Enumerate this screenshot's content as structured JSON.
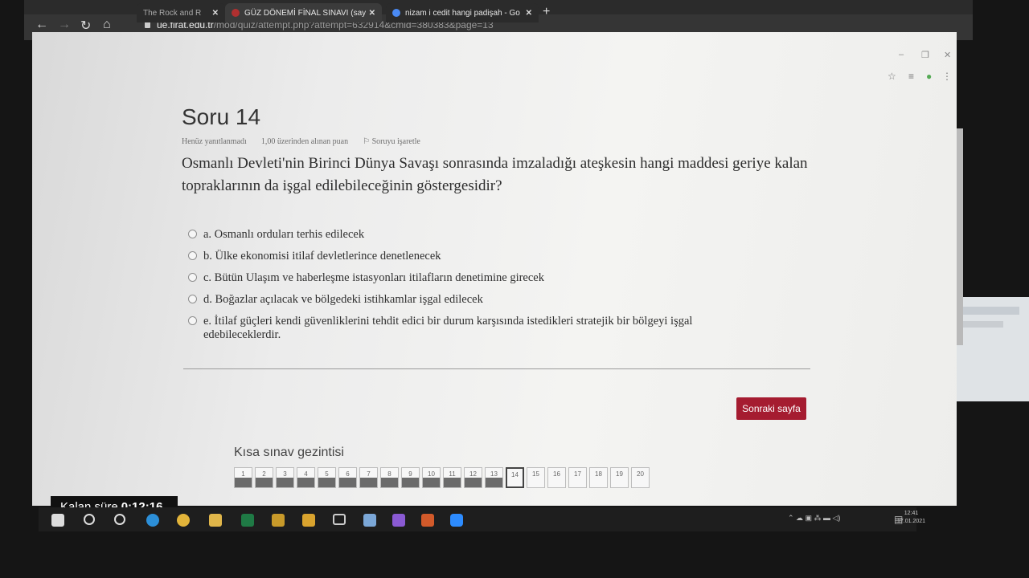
{
  "browser": {
    "tabs": [
      {
        "label": "The Rock and R",
        "active": false
      },
      {
        "label": "GÜZ DÖNEMİ FİNAL SINAVI (say",
        "active": true
      },
      {
        "label": "nizam i cedit hangi padişah - Go",
        "active": false
      }
    ],
    "url_host": "ue.firat.edu.tr",
    "url_path": "/mod/quiz/attempt.php?attempt=632914&cmid=380383&page=13"
  },
  "question": {
    "title": "Soru 14",
    "status": "Henüz yanıtlanmadı",
    "points": "1,00 üzerinden alınan puan",
    "flag_label": "Soruyu işaretle",
    "text": "Osmanlı Devleti'nin Birinci Dünya Savaşı sonrasında imzaladığı ateşkesin hangi maddesi geriye kalan topraklarının da işgal edilebileceğinin göstergesidir?",
    "answers": [
      "a. Osmanlı orduları terhis edilecek",
      "b. Ülke ekonomisi itilaf devletlerince denetlenecek",
      "c. Bütün Ulaşım ve haberleşme istasyonları itilafların denetimine girecek",
      "d. Boğazlar açılacak ve bölgedeki istihkamlar işgal edilecek",
      "e. İtilaf güçleri kendi güvenliklerini tehdit edici bir durum karşısında istedikleri stratejik bir bölgeyi işgal edebileceklerdir."
    ]
  },
  "next_button": "Sonraki sayfa",
  "navigation": {
    "title": "Kısa sınav gezintisi",
    "cells": [
      "1",
      "2",
      "3",
      "4",
      "5",
      "6",
      "7",
      "8",
      "9",
      "10",
      "11",
      "12",
      "13",
      "14",
      "15",
      "16",
      "17",
      "18",
      "19",
      "20"
    ],
    "answered_count": 13,
    "current": "14"
  },
  "timer": {
    "label": "Kalan süre",
    "value": "0:12:16"
  },
  "taskbar": {
    "time": "12:41",
    "date": "17.01.2021"
  },
  "colors": {
    "accent": "#a51c30",
    "chrome_dark": "#353535",
    "taskbar": "#1e1e1e"
  }
}
